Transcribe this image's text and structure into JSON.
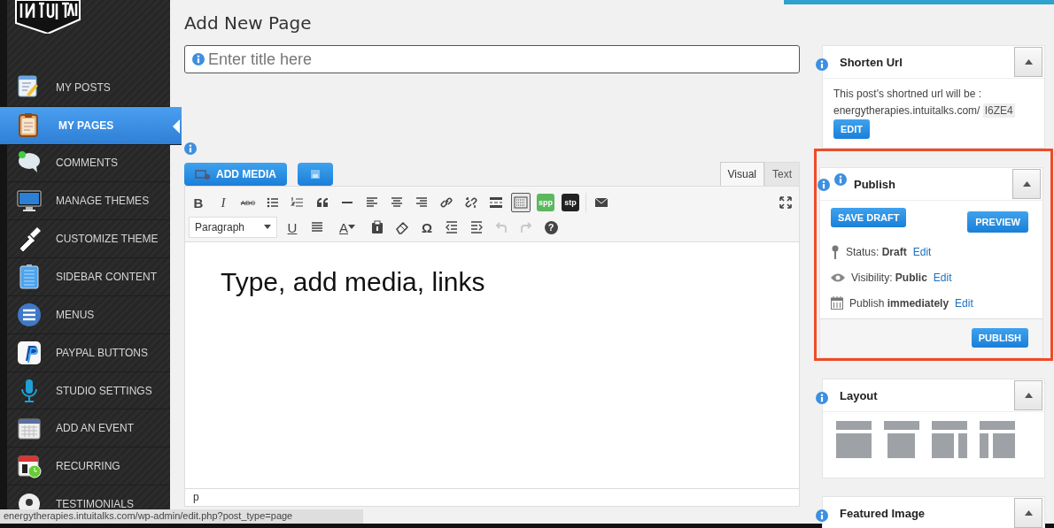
{
  "sidebar": {
    "items": [
      {
        "label": "MY POSTS",
        "selected": false
      },
      {
        "label": "MY PAGES",
        "selected": true
      },
      {
        "label": "COMMENTS",
        "selected": false
      },
      {
        "label": "MANAGE THEMES",
        "selected": false
      },
      {
        "label": "CUSTOMIZE THEME",
        "selected": false
      },
      {
        "label": "SIDEBAR CONTENT",
        "selected": false
      },
      {
        "label": "MENUS",
        "selected": false
      },
      {
        "label": "PAYPAL BUTTONS",
        "selected": false
      },
      {
        "label": "STUDIO SETTINGS",
        "selected": false
      },
      {
        "label": "ADD AN EVENT",
        "selected": false
      },
      {
        "label": "RECURRING",
        "selected": false
      },
      {
        "label": "TESTIMONIALS",
        "selected": false
      }
    ]
  },
  "status_url": "energytherapies.intuitalks.com/wp-admin/edit.php?post_type=page",
  "page_title": "Add New Page",
  "title_field": {
    "placeholder": "Enter title here"
  },
  "media_buttons": [
    {
      "kind": "add-media",
      "label": "ADD MEDIA"
    },
    {
      "kind": "form"
    }
  ],
  "editor_tabs": [
    {
      "label": "Visual",
      "selected": true
    },
    {
      "label": "Text",
      "selected": false
    }
  ],
  "toolbar_rows": [
    [
      {
        "kind": "text",
        "label": "B",
        "selected": false,
        "disabled": false
      },
      {
        "kind": "text-italic",
        "label": "I",
        "selected": false,
        "disabled": false
      },
      {
        "kind": "text-strike",
        "label": "ABC",
        "selected": false,
        "disabled": false
      },
      {
        "kind": "bullets",
        "selected": false,
        "disabled": false
      },
      {
        "kind": "numbers",
        "selected": false,
        "disabled": false
      },
      {
        "kind": "quote",
        "selected": false,
        "disabled": false
      },
      {
        "kind": "hr",
        "selected": false,
        "disabled": false
      },
      {
        "kind": "align-left",
        "selected": false,
        "disabled": false
      },
      {
        "kind": "align-center",
        "selected": false,
        "disabled": false
      },
      {
        "kind": "align-right",
        "selected": false,
        "disabled": false
      },
      {
        "kind": "link",
        "selected": false,
        "disabled": false
      },
      {
        "kind": "unlink",
        "selected": false,
        "disabled": false
      },
      {
        "kind": "more",
        "selected": false,
        "disabled": false
      },
      {
        "kind": "toolbar-toggle",
        "selected": true,
        "disabled": false
      },
      {
        "kind": "badge",
        "label": "spp",
        "color": "#5cb85c",
        "selected": false,
        "disabled": false
      },
      {
        "kind": "badge",
        "label": "stp",
        "color": "#222222",
        "selected": false,
        "disabled": false
      },
      {
        "kind": "mail",
        "selected": false,
        "disabled": false
      }
    ],
    [
      {
        "kind": "format",
        "label": "Paragraph",
        "selected": false,
        "disabled": false
      },
      {
        "kind": "text-underline",
        "label": "U",
        "selected": false,
        "disabled": false
      },
      {
        "kind": "justify",
        "selected": false,
        "disabled": false
      },
      {
        "kind": "text-color",
        "label": "A",
        "selected": false,
        "disabled": false
      },
      {
        "kind": "paste",
        "selected": false,
        "disabled": false
      },
      {
        "kind": "eraser",
        "selected": false,
        "disabled": false
      },
      {
        "kind": "text",
        "label": "Ω",
        "selected": false,
        "disabled": false
      },
      {
        "kind": "outdent",
        "selected": false,
        "disabled": false
      },
      {
        "kind": "indent",
        "selected": false,
        "disabled": false
      },
      {
        "kind": "undo",
        "selected": false,
        "disabled": true
      },
      {
        "kind": "redo",
        "selected": false,
        "disabled": true
      },
      {
        "kind": "help",
        "label": "?",
        "selected": false,
        "disabled": false
      }
    ]
  ],
  "editor_content": "Type, add media, links",
  "editor_path": "p",
  "shorten_url": {
    "title": "Shorten Url",
    "text": "This post's shortned url will be :",
    "domain": "energytherapies.intuitalks.com/",
    "code": "I6ZE4",
    "button": "EDIT"
  },
  "publish": {
    "title": "Publish",
    "save_draft": "SAVE DRAFT",
    "preview": "PREVIEW",
    "rows": [
      {
        "kind": "status",
        "label": "Status:",
        "value": "Draft",
        "link": "Edit"
      },
      {
        "kind": "visibility",
        "label": "Visibility:",
        "value": "Public",
        "link": "Edit"
      },
      {
        "kind": "schedule",
        "label": "Publish",
        "value": "immediately",
        "link": "Edit"
      }
    ],
    "button": "PUBLISH"
  },
  "layout": {
    "title": "Layout"
  },
  "featured_image": {
    "title": "Featured Image"
  }
}
